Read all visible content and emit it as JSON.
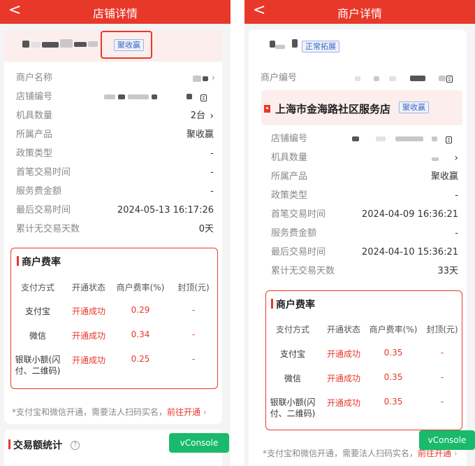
{
  "left": {
    "nav": {
      "back": "<",
      "title": "店铺详情"
    },
    "header_tag": "聚收赢",
    "rows": [
      {
        "label": "商户名称",
        "value": ""
      },
      {
        "label": "店铺编号",
        "value": ""
      },
      {
        "label": "机具数量",
        "value": "2台"
      },
      {
        "label": "所属产品",
        "value": "聚收赢"
      },
      {
        "label": "政策类型",
        "value": "-"
      },
      {
        "label": "首笔交易时间",
        "value": "-"
      },
      {
        "label": "服务费金额",
        "value": "-"
      },
      {
        "label": "最后交易时间",
        "value": "2024-05-13 16:17:26"
      },
      {
        "label": "累计无交易天数",
        "value": "0天"
      }
    ],
    "fee": {
      "title": "商户费率",
      "headers": [
        "支付方式",
        "开通状态",
        "商户费率(%)",
        "封顶(元)"
      ],
      "rows": [
        {
          "method": "支付宝",
          "status": "开通成功",
          "rate": "0.29",
          "cap": "-"
        },
        {
          "method": "微信",
          "status": "开通成功",
          "rate": "0.34",
          "cap": "-"
        },
        {
          "method": "银联小额(闪付、二维码)",
          "status": "开通成功",
          "rate": "0.25",
          "cap": "-"
        }
      ]
    },
    "note": {
      "text": "*支付宝和微信开通，需要法人扫码实名，",
      "link": "前往开通",
      "arrow": "›"
    },
    "trade_title": "交易额统计",
    "info_icon": "?",
    "vconsole": "vConsole"
  },
  "right": {
    "nav": {
      "back": "<",
      "title": "商户详情"
    },
    "status_tag": "正常拓展",
    "merchant_label": "商户编号",
    "shop_name": "上海市金海路社区服务店",
    "shop_tag": "聚收赢",
    "rows": [
      {
        "label": "店铺编号",
        "value": ""
      },
      {
        "label": "机具数量",
        "value": ""
      },
      {
        "label": "所属产品",
        "value": "聚收赢"
      },
      {
        "label": "政策类型",
        "value": "-"
      },
      {
        "label": "首笔交易时间",
        "value": "2024-04-09 16:36:21"
      },
      {
        "label": "服务费金额",
        "value": "-"
      },
      {
        "label": "最后交易时间",
        "value": "2024-04-10 15:36:21"
      },
      {
        "label": "累计无交易天数",
        "value": "33天"
      }
    ],
    "fee": {
      "title": "商户费率",
      "headers": [
        "支付方式",
        "开通状态",
        "商户费率(%)",
        "封顶(元)"
      ],
      "rows": [
        {
          "method": "支付宝",
          "status": "开通成功",
          "rate": "0.35",
          "cap": "-"
        },
        {
          "method": "微信",
          "status": "开通成功",
          "rate": "0.35",
          "cap": "-"
        },
        {
          "method": "银联小额(闪付、二维码)",
          "status": "开通成功",
          "rate": "0.35",
          "cap": "-"
        }
      ]
    },
    "note": {
      "text": "*支付宝和微信开通，需要法人扫码实名，",
      "link": "前往开通",
      "arrow": "›"
    },
    "vconsole": "vConsole"
  },
  "colors": {
    "brand_red": "#e8382a",
    "tag_blue": "#3a67c6",
    "vconsole_green": "#19ba6b"
  },
  "icons": [
    "back-arrow-icon",
    "copy-icon",
    "chevron-right-icon",
    "info-icon",
    "flag-icon"
  ]
}
